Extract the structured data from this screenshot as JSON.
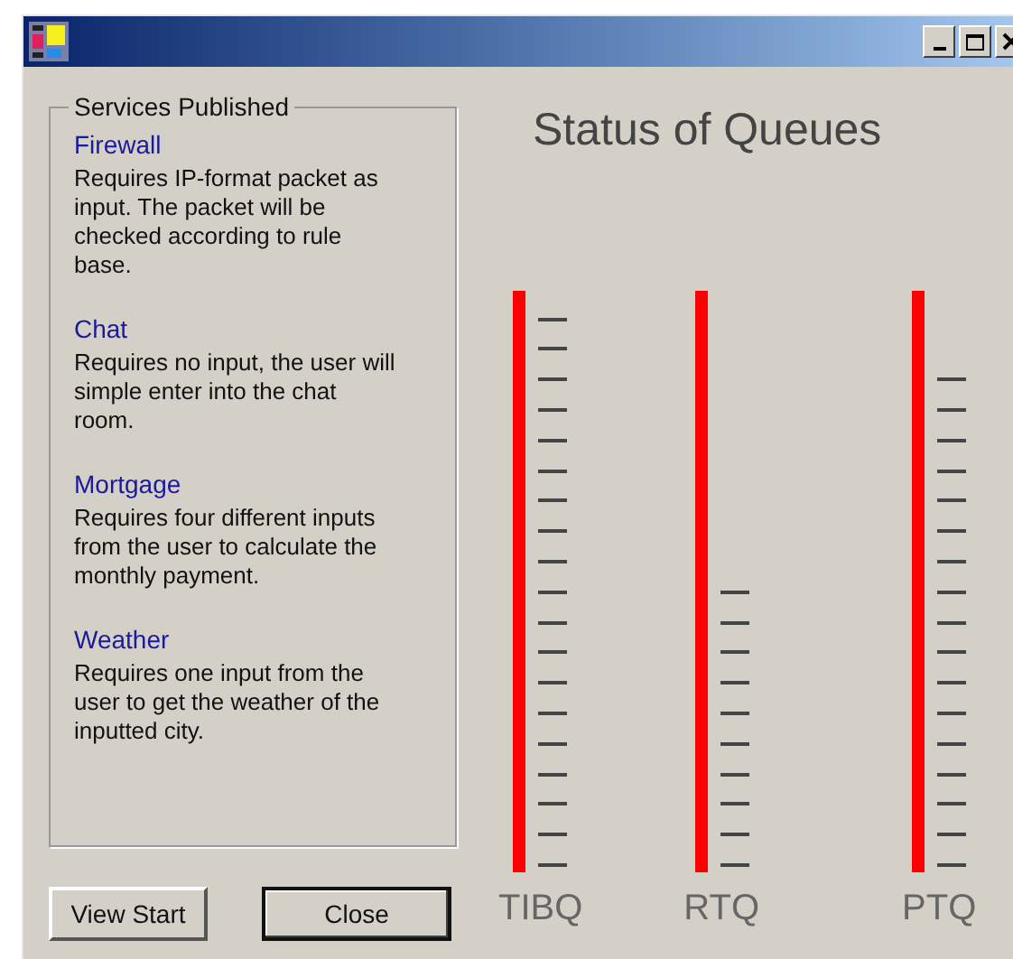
{
  "services": {
    "title": "Services Published",
    "items": [
      {
        "name": "Firewall",
        "description": "Requires IP-format packet as input. The packet will be checked according to rule base."
      },
      {
        "name": "Chat",
        "description": "Requires no input, the user will simple enter into the chat room."
      },
      {
        "name": "Mortgage",
        "description": "Requires four different inputs from the user to calculate the monthly payment."
      },
      {
        "name": "Weather",
        "description": "Requires one input from the user to  get the weather of the inputted city."
      }
    ]
  },
  "buttons": [
    {
      "label": "View Start",
      "selected": false
    },
    {
      "label": "Close",
      "selected": true
    }
  ],
  "queues": {
    "title": "Status of Queues",
    "items": [
      {
        "label": "TIBQ"
      },
      {
        "label": "RTQ"
      },
      {
        "label": "PTQ"
      }
    ]
  }
}
